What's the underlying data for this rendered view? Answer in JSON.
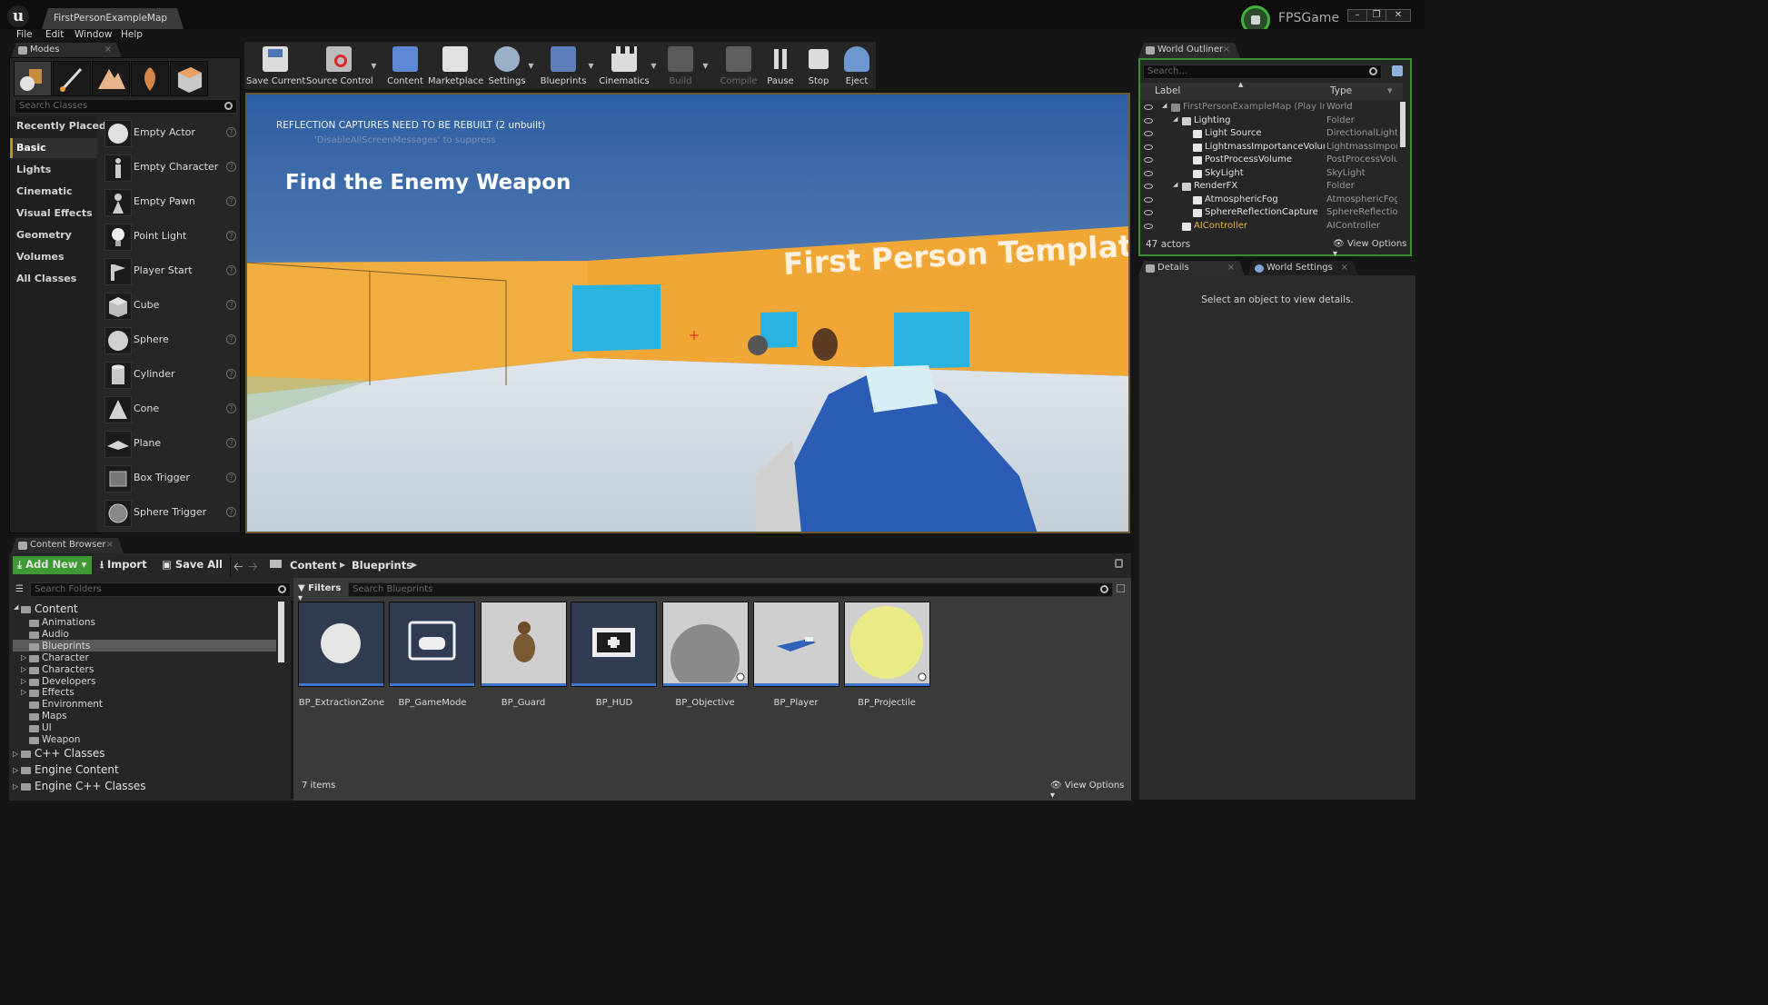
{
  "app": {
    "level_tab": "FirstPersonExampleMap",
    "game_name": "FPSGame",
    "logo": "unreal-logo"
  },
  "menu": [
    "File",
    "Edit",
    "Window",
    "Help"
  ],
  "modes": {
    "tab": "Modes",
    "search_placeholder": "Search Classes",
    "categories": [
      "Recently Placed",
      "Basic",
      "Lights",
      "Cinematic",
      "Visual Effects",
      "Geometry",
      "Volumes",
      "All Classes"
    ],
    "selected_category": "Basic",
    "actors": [
      "Empty Actor",
      "Empty Character",
      "Empty Pawn",
      "Point Light",
      "Player Start",
      "Cube",
      "Sphere",
      "Cylinder",
      "Cone",
      "Plane",
      "Box Trigger",
      "Sphere Trigger"
    ],
    "help_glyph": "?"
  },
  "toolbar": {
    "buttons": [
      "Save Current",
      "Source Control",
      "Content",
      "Marketplace",
      "Settings",
      "Blueprints",
      "Cinematics",
      "Build",
      "Compile",
      "Pause",
      "Stop",
      "Eject"
    ],
    "disabled": [
      "Build",
      "Compile"
    ]
  },
  "viewport": {
    "warning": "REFLECTION CAPTURES NEED TO BE REBUILT (2 unbuilt)",
    "warning_sub": "'DisableAllScreenMessages' to suppress",
    "objective": "Find the Enemy Weapon",
    "wall_text": "First Person Templat"
  },
  "outliner": {
    "tab": "World Outliner",
    "search_placeholder": "Search...",
    "col_label": "Label",
    "col_type": "Type",
    "rows": [
      {
        "label": "FirstPersonExampleMap (Play In Editor)",
        "type": "World",
        "depth": 0
      },
      {
        "label": "Lighting",
        "type": "Folder",
        "depth": 1
      },
      {
        "label": "Light Source",
        "type": "DirectionalLight",
        "depth": 2
      },
      {
        "label": "LightmassImportanceVolume",
        "type": "LightmassImportanceVolume",
        "depth": 2
      },
      {
        "label": "PostProcessVolume",
        "type": "PostProcessVolume",
        "depth": 2
      },
      {
        "label": "SkyLight",
        "type": "SkyLight",
        "depth": 2
      },
      {
        "label": "RenderFX",
        "type": "Folder",
        "depth": 1
      },
      {
        "label": "AtmosphericFog",
        "type": "AtmosphericFog",
        "depth": 2
      },
      {
        "label": "SphereReflectionCapture",
        "type": "SphereReflectionCapture",
        "depth": 2
      },
      {
        "label": "AIController",
        "type": "AIController",
        "depth": 1
      }
    ],
    "count": "47 actors",
    "view_options": "View Options"
  },
  "details": {
    "tab": "Details",
    "tab2": "World Settings",
    "empty": "Select an object to view details."
  },
  "content_browser": {
    "tab": "Content Browser",
    "add_new": "Add New",
    "import": "Import",
    "save_all": "Save All",
    "breadcrumb": [
      "Content",
      "Blueprints"
    ],
    "search_folders": "Search Folders",
    "filters": "Filters",
    "search_assets": "Search Blueprints",
    "tree_root": "Content",
    "tree": [
      "Animations",
      "Audio",
      "Blueprints",
      "Character",
      "Characters",
      "Developers",
      "Effects",
      "Environment",
      "Maps",
      "UI",
      "Weapon"
    ],
    "tree_selected": "Blueprints",
    "other_roots": [
      "C++ Classes",
      "Engine Content",
      "Engine C++ Classes"
    ],
    "assets": [
      "BP_ExtractionZone",
      "BP_GameMode",
      "BP_Guard",
      "BP_HUD",
      "BP_Objective",
      "BP_Player",
      "BP_Projectile"
    ],
    "item_count": "7 items",
    "view_options": "View Options"
  },
  "colors": {
    "accent_green": "#3fb338",
    "selection": "#c88e24",
    "viewport_border": "#6b5a2e",
    "wall": "#f0a735",
    "sky": "#2e5ea3",
    "cube": "#29b3e0"
  }
}
